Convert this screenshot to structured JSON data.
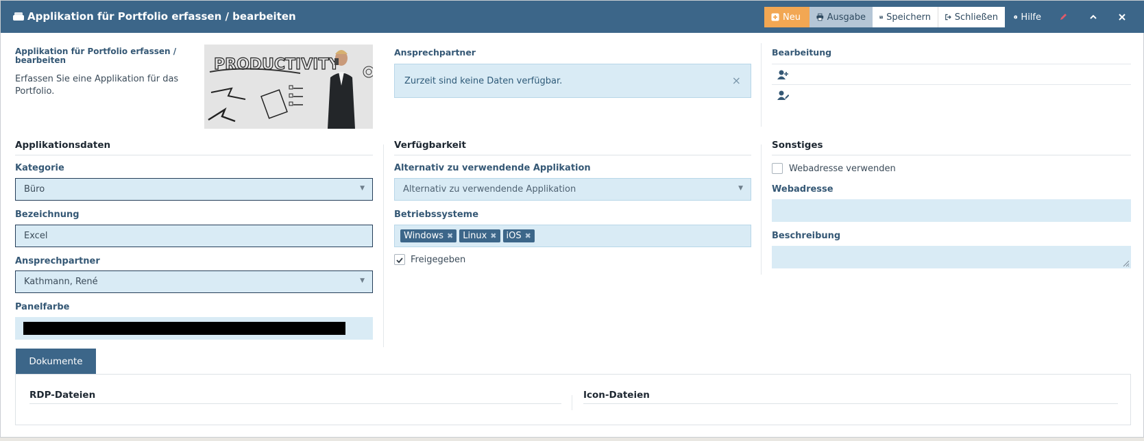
{
  "window": {
    "title": "Applikation für Portfolio erfassen / bearbeiten"
  },
  "toolbar": {
    "neu": "Neu",
    "ausgabe": "Ausgabe",
    "speichern": "Speichern",
    "schliessen": "Schließen",
    "hilfe": "Hilfe"
  },
  "intro": {
    "title": "Applikation für Portfolio erfassen / bearbeiten",
    "description": "Erfassen Sie eine Applikation für das Portfolio.",
    "image_text": "PRODUCTIVITY"
  },
  "ansprechpartner_panel": {
    "label": "Ansprechpartner",
    "alert": "Zurzeit sind keine Daten verfügbar.",
    "close_glyph": "×"
  },
  "bearbeitung": {
    "label": "Bearbeitung"
  },
  "applikationsdaten": {
    "heading": "Applikationsdaten",
    "kategorie_label": "Kategorie",
    "kategorie_value": "Büro",
    "bezeichnung_label": "Bezeichnung",
    "bezeichnung_value": "Excel",
    "ansprechpartner_label": "Ansprechpartner",
    "ansprechpartner_value": "Kathmann, René",
    "panelfarbe_label": "Panelfarbe",
    "panelfarbe_value": "#000000"
  },
  "verfuegbarkeit": {
    "heading": "Verfügbarkeit",
    "alternativ_label": "Alternativ zu verwendende Applikation",
    "alternativ_placeholder": "Alternativ zu verwendende Applikation",
    "betriebssysteme_label": "Betriebssysteme",
    "betriebssysteme": [
      "Windows",
      "Linux",
      "iOS"
    ],
    "freigegeben_label": "Freigegeben",
    "freigegeben_checked": true
  },
  "sonstiges": {
    "heading": "Sonstiges",
    "webadresse_checkbox_label": "Webadresse verwenden",
    "webadresse_checked": false,
    "webadresse_label": "Webadresse",
    "webadresse_value": "",
    "beschreibung_label": "Beschreibung",
    "beschreibung_value": ""
  },
  "tabs": {
    "dokumente": "Dokumente",
    "rdp_heading": "RDP-Dateien",
    "icon_heading": "Icon-Dateien"
  },
  "colors": {
    "titlebar": "#3c6689",
    "neu_button": "#f2a753",
    "ausgabe_button": "#b5c6d6",
    "field_bg": "#d9ebf5",
    "label": "#355875"
  }
}
